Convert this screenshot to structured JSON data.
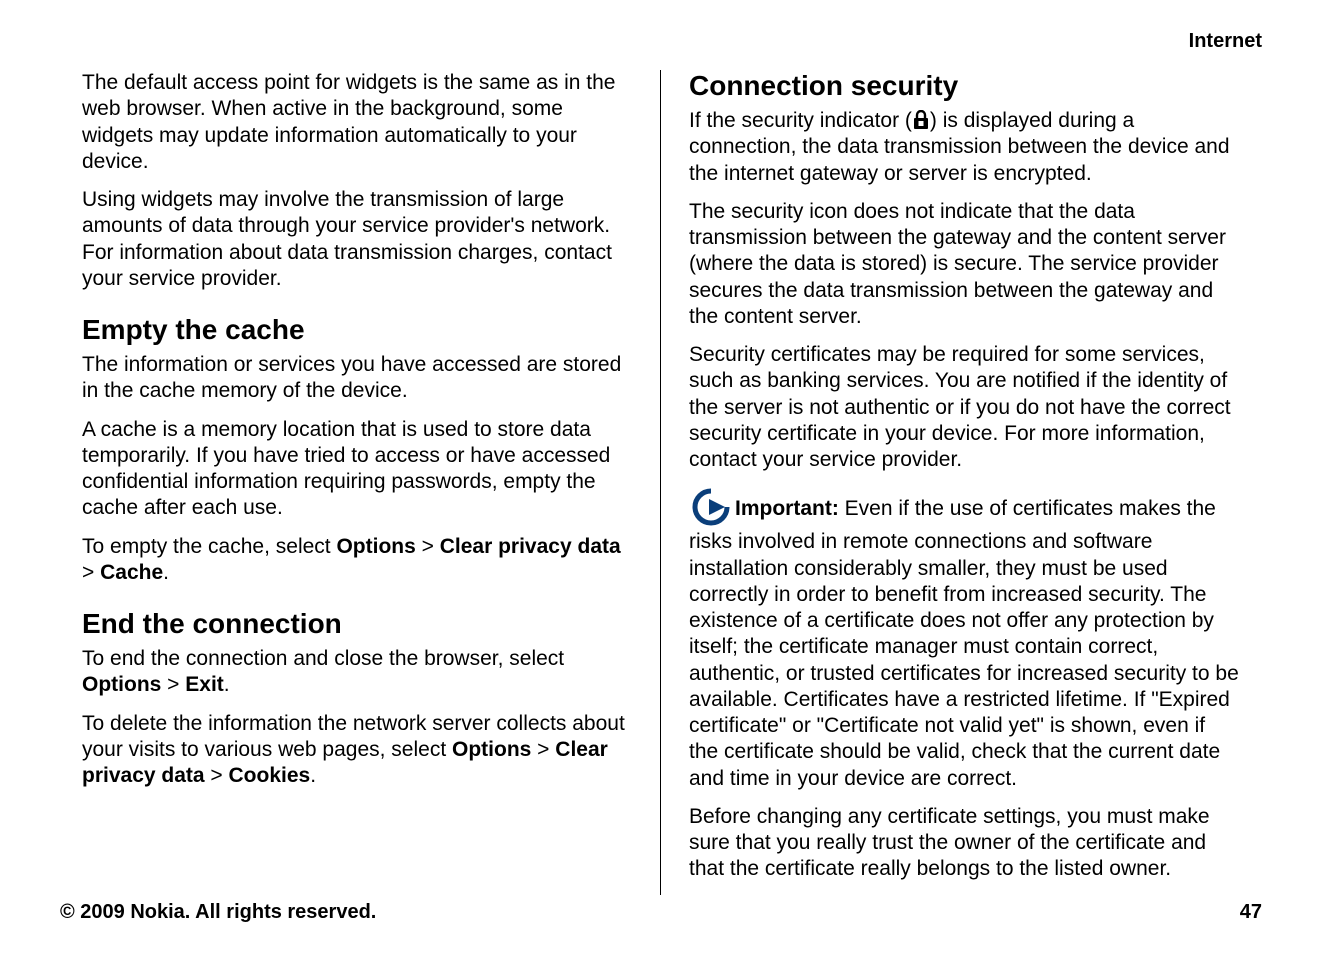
{
  "header": {
    "category": "Internet"
  },
  "left": {
    "intro_p1": "The default access point for widgets is the same as in the web browser. When active in the background, some widgets may update information automatically to your device.",
    "intro_p2": "Using widgets may involve the transmission of large amounts of data through your service provider's network. For information about data transmission charges, contact your service provider.",
    "h_empty_cache": "Empty the cache",
    "empty_p1": "The information or services you have accessed are stored in the cache memory of the device.",
    "empty_p2": "A cache is a memory location that is used to store data temporarily. If you have tried to access or have accessed confidential information requiring passwords, empty the cache after each use.",
    "empty_p3_pre": "To empty the cache, select ",
    "empty_p3_opt": "Options",
    "empty_p3_gt1": " > ",
    "empty_p3_cpd": "Clear privacy data",
    "empty_p3_gt2": " > ",
    "empty_p3_cache": "Cache",
    "empty_p3_post": ".",
    "h_end_conn": "End the connection",
    "end_p1_pre": "To end the connection and close the browser, select ",
    "end_p1_opt": "Options",
    "end_p1_gt": " > ",
    "end_p1_exit": "Exit",
    "end_p1_post": ".",
    "end_p2_pre": "To delete the information the network server collects about your visits to various web pages, select ",
    "end_p2_opt": "Options",
    "end_p2_gt1": " > ",
    "end_p2_cpd": "Clear privacy data",
    "end_p2_gt2": " > ",
    "end_p2_cookies": "Cookies",
    "end_p2_post": "."
  },
  "right": {
    "h_conn_sec": "Connection security",
    "sec_p1_pre": "If the security indicator (",
    "sec_p1_post": ") is displayed during a connection, the data transmission between the device and the internet gateway or server is encrypted.",
    "sec_p2": "The security icon does not indicate that the data transmission between the gateway and the content server (where the data is stored) is secure. The service provider secures the data transmission between the gateway and the content server.",
    "sec_p3": "Security certificates may be required for some services, such as banking services. You are notified if the identity of the server is not authentic or if you do not have the correct security certificate in your device. For more information, contact your service provider.",
    "important_label": "Important:",
    "important_body": "  Even if the use of certificates makes the risks involved in remote connections and software installation considerably smaller, they must be used correctly in order to benefit from increased security. The existence of a certificate does not offer any protection by itself; the certificate manager must contain correct, authentic, or trusted certificates for increased security to be available. Certificates have a restricted lifetime. If \"Expired certificate\" or \"Certificate not valid yet\" is shown, even if the certificate should be valid, check that the current date and time in your device are correct.",
    "sec_p5": "Before changing any certificate settings, you must make sure that you really trust the owner of the certificate and that the certificate really belongs to the listed owner."
  },
  "footer": {
    "copyright": "© 2009 Nokia. All rights reserved.",
    "page_number": "47"
  },
  "icons": {
    "lock": "lock-icon",
    "note": "note-arrow-icon"
  }
}
